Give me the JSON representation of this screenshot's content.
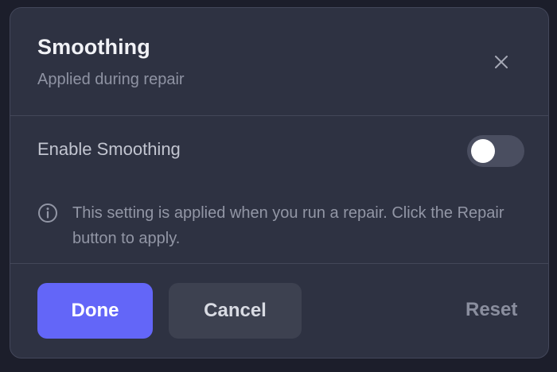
{
  "dialog": {
    "title": "Smoothing",
    "subtitle": "Applied during repair",
    "close_icon": "close-icon"
  },
  "setting": {
    "label": "Enable Smoothing",
    "enabled": false
  },
  "info": {
    "icon": "info-icon",
    "text": "This setting is applied when you run a repair. Click the Repair button to apply."
  },
  "footer": {
    "done_label": "Done",
    "cancel_label": "Cancel",
    "reset_label": "Reset"
  },
  "colors": {
    "accent": "#6366f8",
    "background": "#2e3242",
    "toggle_off": "#4a4e60"
  }
}
